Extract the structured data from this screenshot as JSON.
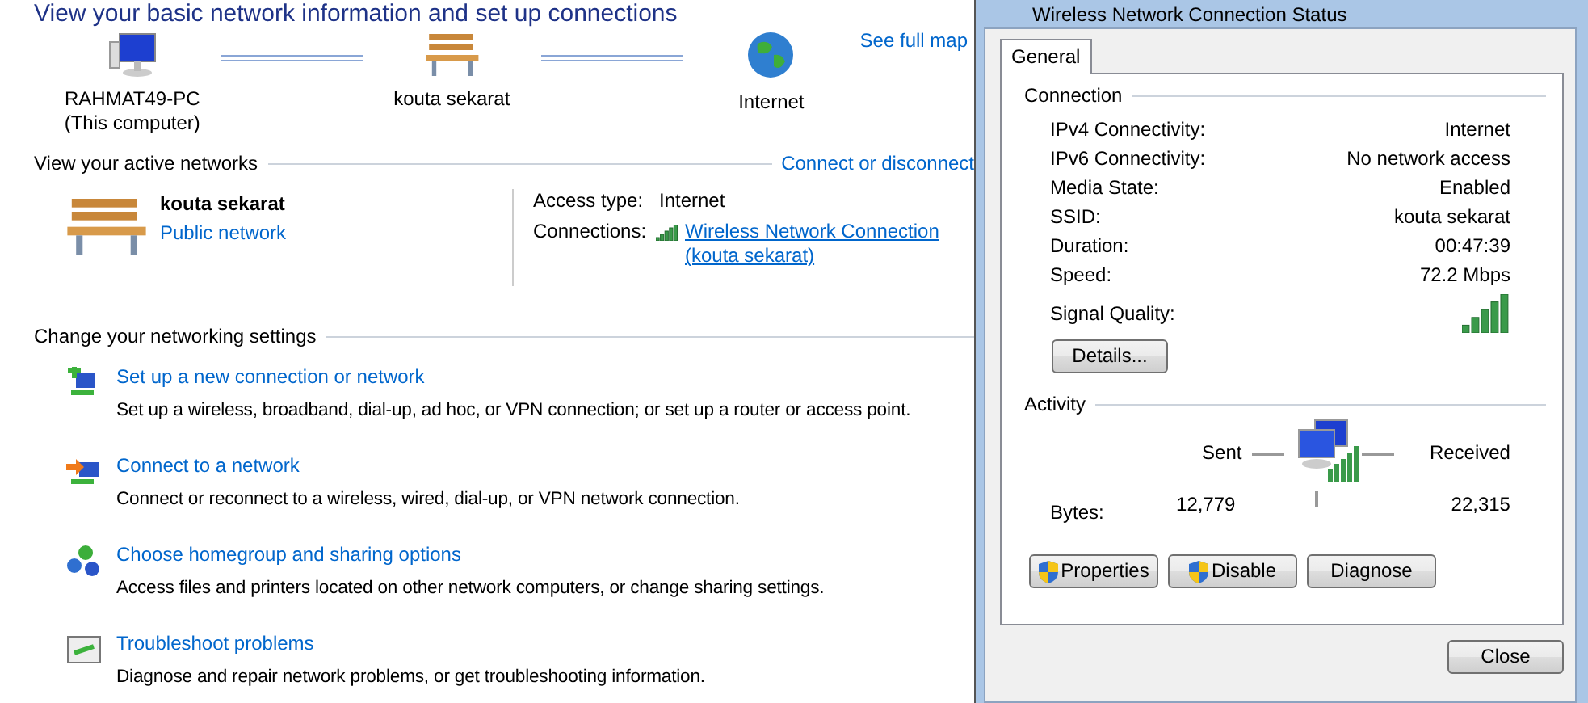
{
  "page_title": "View your basic network information and set up connections",
  "network_map": {
    "nodes": [
      {
        "kind": "computer",
        "label": "RAHMAT49-PC",
        "sublabel": "(This computer)"
      },
      {
        "kind": "network",
        "label": "kouta sekarat"
      },
      {
        "kind": "internet",
        "label": "Internet"
      }
    ],
    "see_full_map": "See full map"
  },
  "active_networks": {
    "heading": "View your active networks",
    "action": "Connect or disconnect",
    "network": {
      "name": "kouta sekarat",
      "category": "Public network"
    },
    "details": [
      {
        "kind": "text",
        "label": "Access type:",
        "value": "Internet"
      },
      {
        "kind": "link",
        "label": "Connections:",
        "value": "Wireless Network Connection (kouta sekarat)"
      }
    ]
  },
  "settings": {
    "heading": "Change your networking settings",
    "tasks": [
      {
        "kind": "new-connection",
        "title": "Set up a new connection or network",
        "description": "Set up a wireless, broadband, dial-up, ad hoc, or VPN connection; or set up a router or access point."
      },
      {
        "kind": "connect",
        "title": "Connect to a network",
        "description": "Connect or reconnect to a wireless, wired, dial-up, or VPN network connection."
      },
      {
        "kind": "homegroup",
        "title": "Choose homegroup and sharing options",
        "description": "Access files and printers located on other network computers, or change sharing settings."
      },
      {
        "kind": "troubleshoot",
        "title": "Troubleshoot problems",
        "description": "Diagnose and repair network problems, or get troubleshooting information."
      }
    ]
  },
  "dialog": {
    "title": "Wireless Network Connection Status",
    "tabs": [
      {
        "label": "General",
        "selected": true
      }
    ],
    "connection": {
      "heading": "Connection",
      "rows": [
        {
          "label": "IPv4 Connectivity:",
          "value": "Internet"
        },
        {
          "label": "IPv6 Connectivity:",
          "value": "No network access"
        },
        {
          "label": "Media State:",
          "value": "Enabled"
        },
        {
          "label": "SSID:",
          "value": "kouta sekarat"
        },
        {
          "label": "Duration:",
          "value": "00:47:39"
        },
        {
          "label": "Speed:",
          "value": "72.2 Mbps"
        }
      ],
      "signal_label": "Signal Quality:"
    },
    "details_button": "Details...",
    "activity": {
      "heading": "Activity",
      "sent": "Sent",
      "received": "Received",
      "bytes_label": "Bytes:",
      "bytes_sent": "12,779",
      "bytes_received": "22,315"
    },
    "buttons": [
      {
        "label": "Properties",
        "shield": true
      },
      {
        "label": "Disable",
        "shield": true
      },
      {
        "label": "Diagnose",
        "shield": false
      }
    ],
    "close_button": "Close"
  }
}
